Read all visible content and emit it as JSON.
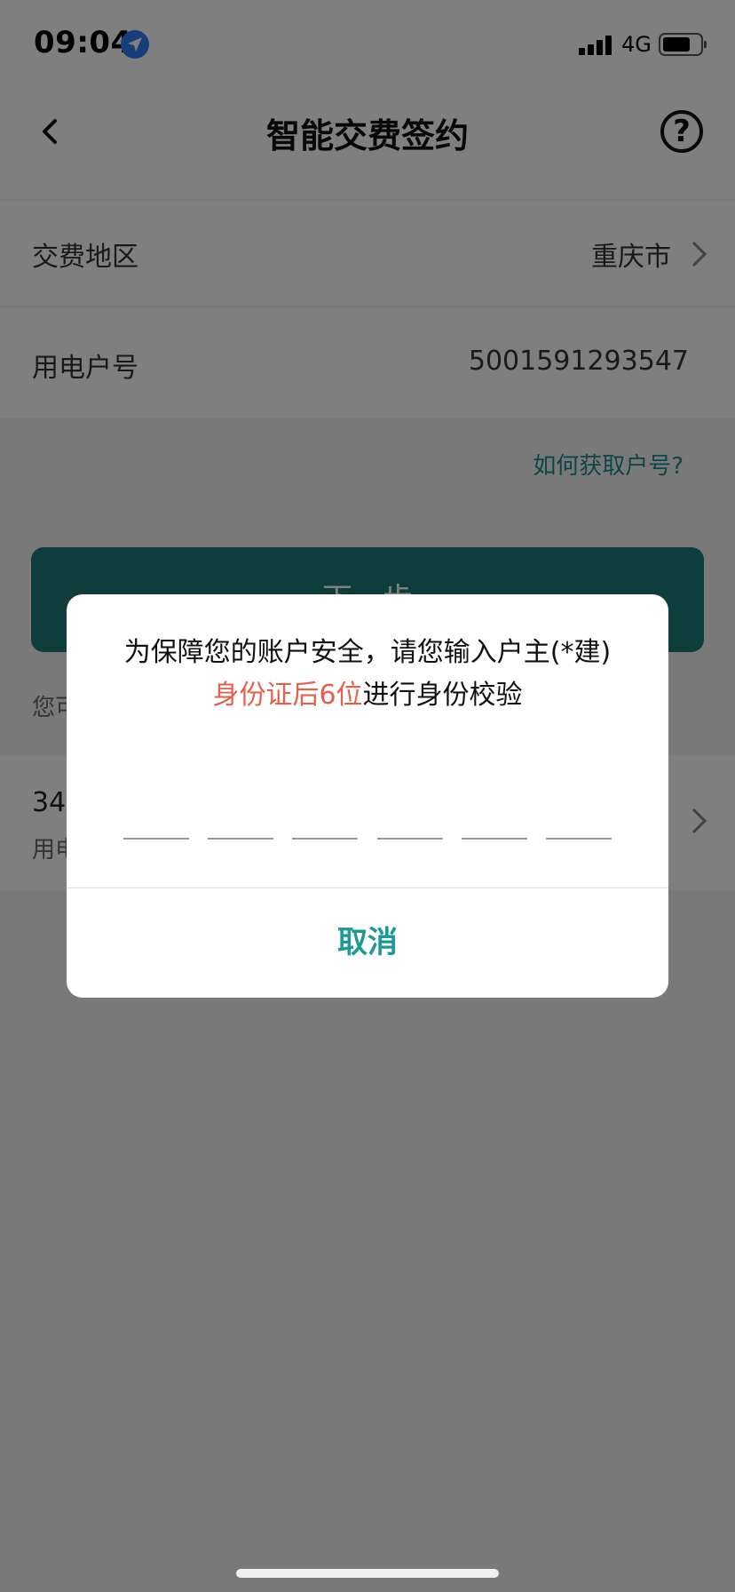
{
  "status": {
    "time": "09:04",
    "network": "4G"
  },
  "nav": {
    "title": "智能交费签约",
    "help": "?"
  },
  "form": {
    "region_label": "交费地区",
    "region_value": "重庆市",
    "account_label": "用电户号",
    "account_value": "5001591293547"
  },
  "link_how_to_get": "如何获取户号?",
  "next_button": "下一步",
  "hint_partial": "您可",
  "account_item": {
    "number_partial": "34",
    "sub_partial": "用电"
  },
  "dialog": {
    "message_line1": "为保障您的账户安全，请您输入户主(*建)",
    "message_highlight": "身份证后6位",
    "message_line2_suffix": "进行身份校验",
    "pin_slots": 6,
    "cancel_label": "取消"
  },
  "colors": {
    "accent": "#1a7d79",
    "highlight": "#e5604a",
    "cancel": "#1b9a96"
  }
}
